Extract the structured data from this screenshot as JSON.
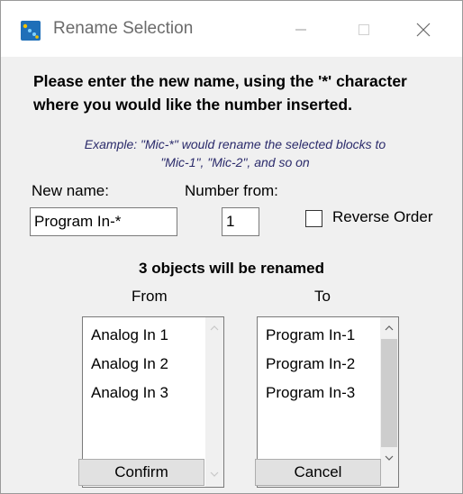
{
  "window": {
    "title": "Rename Selection",
    "icon": "rename-app-icon",
    "controls": [
      "minimize-icon",
      "maximize-icon",
      "close-icon"
    ]
  },
  "instructions": {
    "line1": "Please enter the new name, using the '*' character",
    "line2": "where you would like the number inserted.",
    "example_line1": "Example: \"Mic-*\" would rename the selected blocks to",
    "example_line2": "\"Mic-1\", \"Mic-2\", and so on"
  },
  "form": {
    "new_name_label": "New name:",
    "new_name_value": "Program In-*",
    "number_from_label": "Number from:",
    "number_from_value": "1",
    "reverse_order_label": "Reverse Order",
    "reverse_order_checked": false
  },
  "summary": {
    "count_text": "3 objects will be renamed",
    "from_header": "From",
    "to_header": "To"
  },
  "from_list": [
    "Analog In 1",
    "Analog In 2",
    "Analog In 3"
  ],
  "to_list": [
    "Program In-1",
    "Program In-2",
    "Program In-3"
  ],
  "buttons": {
    "confirm": "Confirm",
    "cancel": "Cancel"
  },
  "colors": {
    "background": "#f0f0f0",
    "titlebar": "#ffffff",
    "example_text": "#2b2b6b",
    "button_face": "#e1e1e1",
    "scroll_thumb": "#cdcdcd"
  }
}
